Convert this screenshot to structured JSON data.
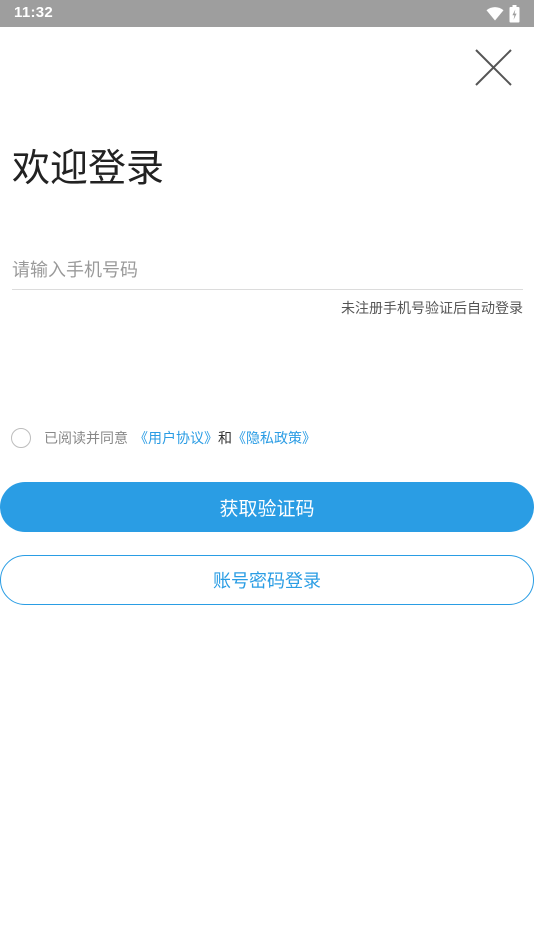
{
  "status_bar": {
    "time": "11:32",
    "icons": [
      "wifi-icon",
      "battery-icon"
    ]
  },
  "header": {
    "close_icon": "close-icon"
  },
  "title": "欢迎登录",
  "phone_input": {
    "placeholder": "请输入手机号码",
    "value": ""
  },
  "hint": "未注册手机号验证后自动登录",
  "agreement": {
    "checked": false,
    "prefix": "已阅读并同意",
    "user_agreement": "《用户协议》",
    "and": "和",
    "privacy_policy": "《隐私政策》"
  },
  "buttons": {
    "get_code": "获取验证码",
    "password_login": "账号密码登录"
  },
  "colors": {
    "accent": "#2a9de4",
    "status_bar": "#9e9e9e"
  }
}
